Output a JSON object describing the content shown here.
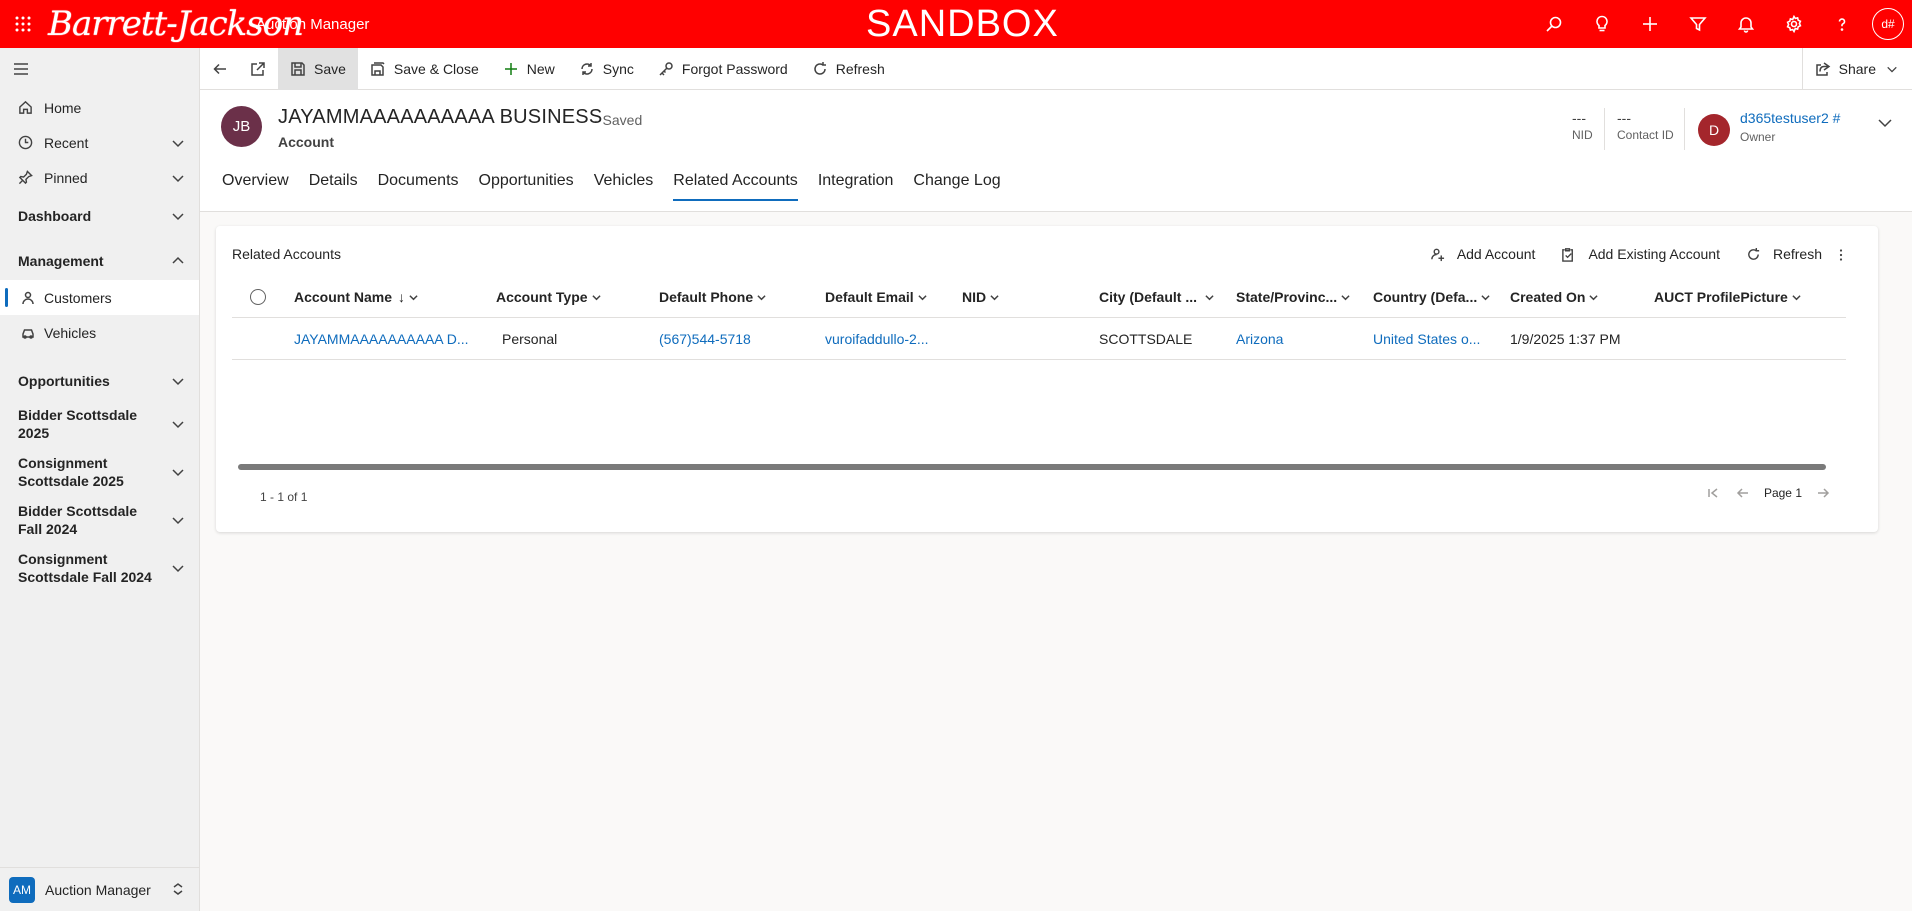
{
  "topbar": {
    "logo_text": "Barrett-Jackson",
    "app_name": "Auction Manager",
    "environment": "SANDBOX",
    "user_initials": "d#",
    "icons": [
      "search-icon",
      "lightbulb-icon",
      "plus-icon",
      "filter-icon",
      "bell-icon",
      "gear-icon",
      "help-icon"
    ]
  },
  "sidebar": {
    "home": "Home",
    "recent": "Recent",
    "pinned": "Pinned",
    "dashboard": "Dashboard",
    "management": "Management",
    "customers": "Customers",
    "vehicles": "Vehicles",
    "opportunities": "Opportunities",
    "groups": [
      "Bidder Scottsdale 2025",
      "Consignment Scottsdale 2025",
      "Bidder Scottsdale Fall 2024",
      "Consignment Scottsdale Fall 2024"
    ],
    "area_badge": "AM",
    "area_name": "Auction Manager"
  },
  "commandbar": {
    "save": "Save",
    "save_close": "Save & Close",
    "new": "New",
    "sync": "Sync",
    "forgot_password": "Forgot Password",
    "refresh": "Refresh",
    "share": "Share"
  },
  "record": {
    "initials": "JB",
    "title": "JAYAMMAAAAAAAAAA BUSINESS",
    "status": "- Saved",
    "entity": "Account",
    "nid_value": "---",
    "nid_label": "NID",
    "contact_id_value": "---",
    "contact_id_label": "Contact ID",
    "owner_initial": "D",
    "owner_name": "d365testuser2 #",
    "owner_label": "Owner"
  },
  "tabs": [
    "Overview",
    "Details",
    "Documents",
    "Opportunities",
    "Vehicles",
    "Related Accounts",
    "Integration",
    "Change Log"
  ],
  "active_tab": "Related Accounts",
  "subgrid": {
    "title": "Related Accounts",
    "actions": {
      "add_account": "Add Account",
      "add_existing": "Add Existing Account",
      "refresh": "Refresh"
    },
    "columns": [
      "Account Name",
      "Account Type",
      "Default Phone",
      "Default Email",
      "NID",
      "City (Default ...",
      "State/Provinc...",
      "Country (Defa...",
      "Created On",
      "AUCT ProfilePicture"
    ],
    "sort_indicator": "↓",
    "rows": [
      {
        "account_name": "JAYAMMAAAAAAAAAA D...",
        "account_type": "Personal",
        "phone": "(567)544-5718",
        "email": "vuroifaddullo-2...",
        "nid": "",
        "city": "SCOTTSDALE",
        "state": "Arizona",
        "country": "United States o...",
        "created_on": "1/9/2025 1:37 PM",
        "profile_picture": ""
      }
    ],
    "count_text": "1 - 1 of 1",
    "page_text": "Page 1"
  },
  "colors": {
    "topbar": "#ff0000",
    "accent": "#0f6cbd",
    "record_avatar": "#6b3049",
    "owner_avatar": "#a4262c"
  }
}
